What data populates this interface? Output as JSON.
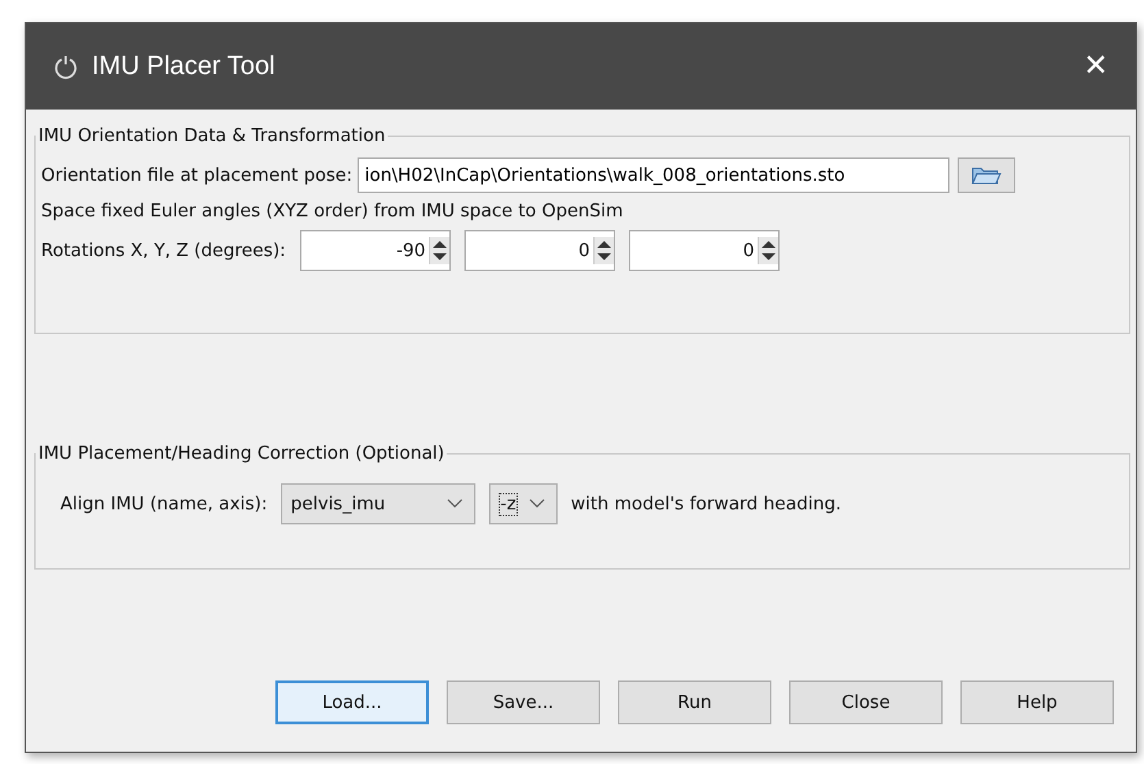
{
  "window": {
    "title": "IMU Placer Tool",
    "close": "✕"
  },
  "orientation_group": {
    "title": "IMU Orientation Data & Transformation",
    "file_label": "Orientation file at placement pose:",
    "file_value": "ion\\H02\\InCap\\Orientations\\walk_008_orientations.sto",
    "note": "Space fixed Euler angles (XYZ order) from IMU space to OpenSim",
    "rotations_label": "Rotations X, Y, Z (degrees):",
    "rotations": [
      "-90",
      "0",
      "0"
    ]
  },
  "heading_group": {
    "title": "IMU Placement/Heading Correction (Optional)",
    "align_label": "Align IMU (name, axis):",
    "imu_value": "pelvis_imu",
    "axis_value": "-z",
    "suffix": "with model's forward heading."
  },
  "buttons": [
    {
      "label": "Load...",
      "focused": true
    },
    {
      "label": "Save...",
      "focused": false
    },
    {
      "label": "Run",
      "focused": false
    },
    {
      "label": "Close",
      "focused": false
    },
    {
      "label": "Help",
      "focused": false
    }
  ]
}
